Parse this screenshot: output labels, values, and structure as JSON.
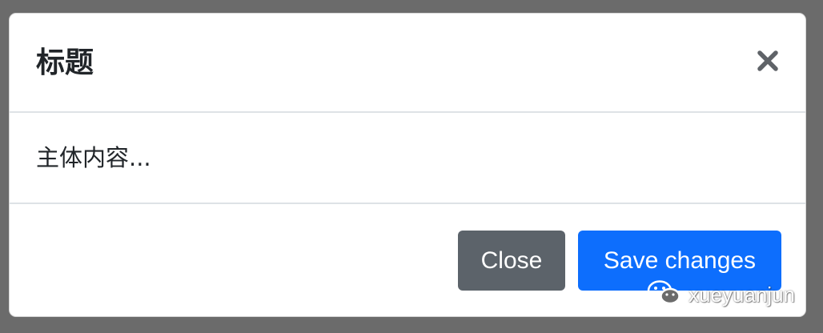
{
  "modal": {
    "title": "标题",
    "body_text": "主体内容...",
    "close_icon": "close-icon",
    "footer": {
      "close_label": "Close",
      "save_label": "Save changes"
    }
  },
  "watermark": {
    "icon": "wechat-icon",
    "text": "xueyuanjun"
  },
  "colors": {
    "backdrop": "#6b6b6b",
    "modal_bg": "#ffffff",
    "divider": "#dee2e6",
    "text": "#212529",
    "close_x": "#5f6368",
    "secondary_button": "#5c636a",
    "primary_button": "#0d6efd"
  }
}
